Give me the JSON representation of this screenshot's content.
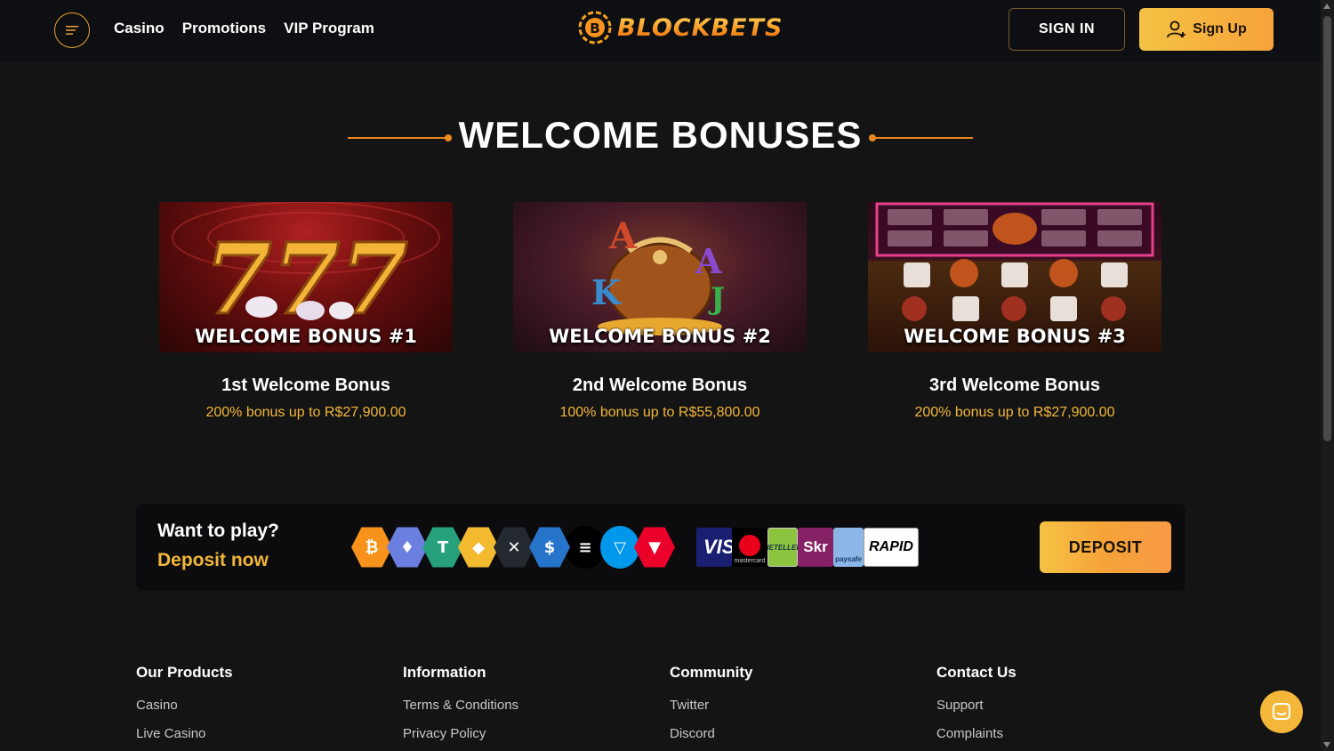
{
  "header": {
    "nav": [
      "Casino",
      "Promotions",
      "VIP Program"
    ],
    "logo_text": "BLOCKBETS",
    "sign_in": "SIGN IN",
    "sign_up": "Sign Up"
  },
  "section": {
    "title": "WELCOME BONUSES"
  },
  "bonuses": [
    {
      "banner": "WELCOME BONUS #1",
      "title": "1st Welcome Bonus",
      "subtitle": "200% bonus up to R$27,900.00"
    },
    {
      "banner": "WELCOME BONUS #2",
      "title": "2nd Welcome Bonus",
      "subtitle": "100% bonus up to R$55,800.00"
    },
    {
      "banner": "WELCOME BONUS #3",
      "title": "3rd Welcome Bonus",
      "subtitle": "200% bonus up to R$27,900.00"
    }
  ],
  "deposit": {
    "line1": "Want to play?",
    "line2": "Deposit now",
    "button": "DEPOSIT",
    "crypto_icons": [
      "bitcoin-icon",
      "ethereum-icon",
      "tether-icon",
      "binance-icon",
      "xrp-icon",
      "usdc-icon",
      "solana-icon",
      "ton-icon",
      "tron-icon"
    ],
    "payment_labels": [
      "VIS",
      "mastercard",
      "NETELLER",
      "Skr",
      "paysafe",
      "RAPID"
    ]
  },
  "footer": {
    "columns": [
      {
        "title": "Our Products",
        "links": [
          "Casino",
          "Live Casino"
        ]
      },
      {
        "title": "Information",
        "links": [
          "Terms & Conditions",
          "Privacy Policy"
        ]
      },
      {
        "title": "Community",
        "links": [
          "Twitter",
          "Discord"
        ]
      },
      {
        "title": "Contact Us",
        "links": [
          "Support",
          "Complaints"
        ]
      }
    ]
  },
  "colors": {
    "accent": "#f5b73a",
    "gold_text": "#f2b63a",
    "background": "#141414",
    "header": "#0e0f12"
  }
}
